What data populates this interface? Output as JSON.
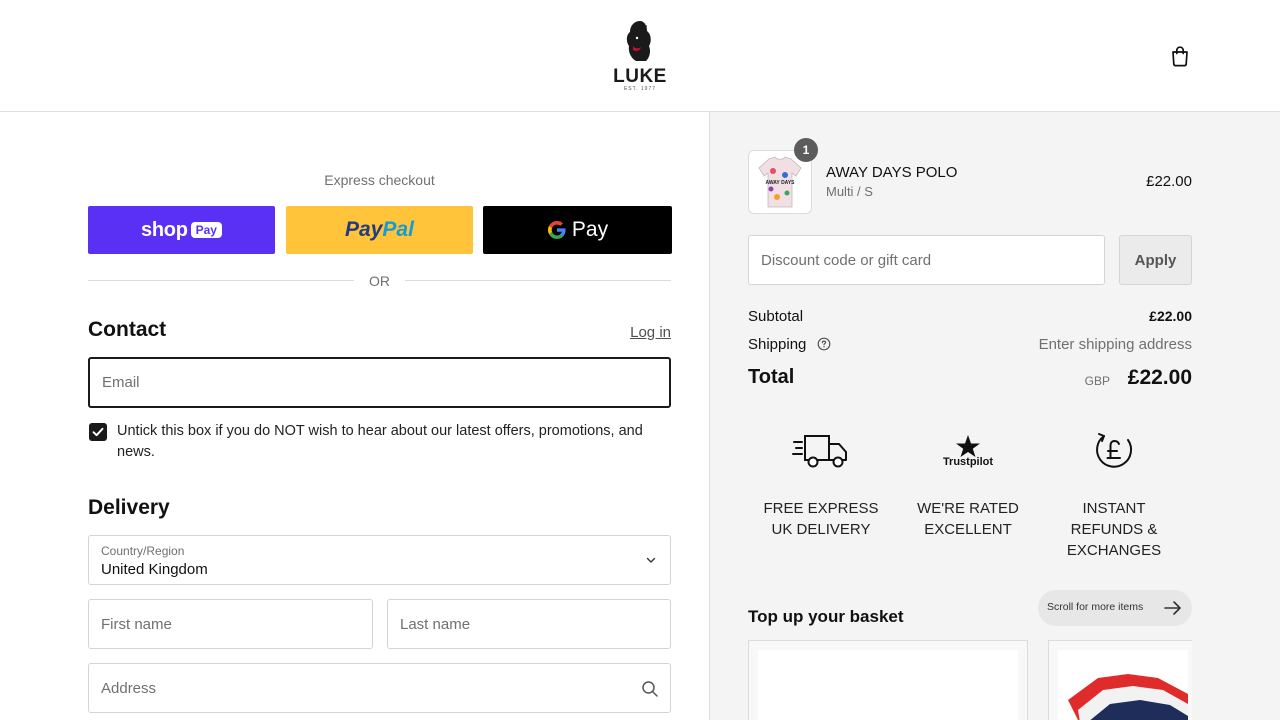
{
  "brand": {
    "name": "LUKE",
    "est": "EST. 1977"
  },
  "header": {
    "cart_icon": "shopping-bag-icon"
  },
  "express": {
    "label": "Express checkout",
    "shop_pay": {
      "word": "shop",
      "pill": "Pay"
    },
    "paypal": {
      "part1": "Pay",
      "part2": "Pal"
    },
    "gpay": {
      "g": "G",
      "word": "Pay"
    },
    "or_text": "OR"
  },
  "contact": {
    "title": "Contact",
    "login": "Log in",
    "email_placeholder": "Email",
    "marketing_checked": true,
    "marketing_text": "Untick this box if you do NOT wish to hear about our latest offers, promotions, and news."
  },
  "delivery": {
    "title": "Delivery",
    "country_label": "Country/Region",
    "country_value": "United Kingdom",
    "first_name_placeholder": "First name",
    "last_name_placeholder": "Last name",
    "address_placeholder": "Address"
  },
  "order": {
    "item": {
      "quantity": "1",
      "name": "AWAY DAYS POLO",
      "variant": "Multi / S",
      "price": "£22.00",
      "print": "AWAY DAYS"
    },
    "discount_placeholder": "Discount code or gift card",
    "apply_label": "Apply",
    "subtotal_label": "Subtotal",
    "subtotal_value": "£22.00",
    "shipping_label": "Shipping",
    "shipping_value": "Enter shipping address",
    "total_label": "Total",
    "total_currency": "GBP",
    "total_value": "£22.00"
  },
  "features": [
    {
      "icon": "delivery-truck-icon",
      "line1": "FREE EXPRESS",
      "line2": "UK DELIVERY",
      "line3": ""
    },
    {
      "icon": "trustpilot-star-icon",
      "badge": "Trustpilot",
      "line1": "WE'RE RATED",
      "line2": "EXCELLENT",
      "line3": ""
    },
    {
      "icon": "pound-refund-icon",
      "line1": "INSTANT",
      "line2": "REFUNDS &",
      "line3": "EXCHANGES"
    }
  ],
  "upsell": {
    "title": "Top up your basket",
    "scroll_label": "Scroll for more items"
  },
  "colors": {
    "shop_pay": "#5a31f4",
    "paypal": "#ffc439",
    "gpay": "#000000",
    "panel": "#f4f4f4",
    "ink": "#1a1a1a"
  }
}
